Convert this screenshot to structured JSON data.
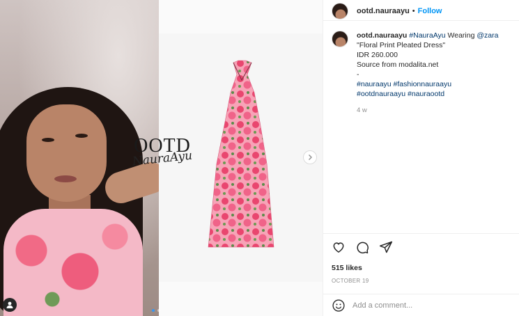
{
  "post": {
    "username": "ootd.nauraayu",
    "separator": "•",
    "follow_label": "Follow",
    "watermark_main": "OOTD",
    "watermark_sub": "NauraAyu",
    "caption": {
      "username": "ootd.nauraayu",
      "hashtag_main": "#NauraAyu",
      "text_wearing": "Wearing",
      "mention": "@zara",
      "line2": "\"Floral Print Pleated Dress\"",
      "line3": "IDR 260.000",
      "line4": "Source from modalita.net",
      "line5": "-",
      "hashtags_line1_a": "#nauraayu",
      "hashtags_line1_b": "#fashionnauraayu",
      "hashtags_line2_a": "#ootdnauraayu",
      "hashtags_line2_b": "#nauraootd"
    },
    "time_ago": "4 w",
    "likes": "515 likes",
    "date": "OCTOBER 19",
    "comment_placeholder": "Add a comment..."
  },
  "icons": {
    "like": "heart-icon",
    "comment": "comment-icon",
    "share": "paper-plane-icon",
    "next": "chevron-right-icon",
    "emoji": "emoji-icon",
    "tag": "user-tag-icon"
  },
  "colors": {
    "link": "#00376b",
    "follow": "#0095f6",
    "active_dot": "#3897f0"
  }
}
